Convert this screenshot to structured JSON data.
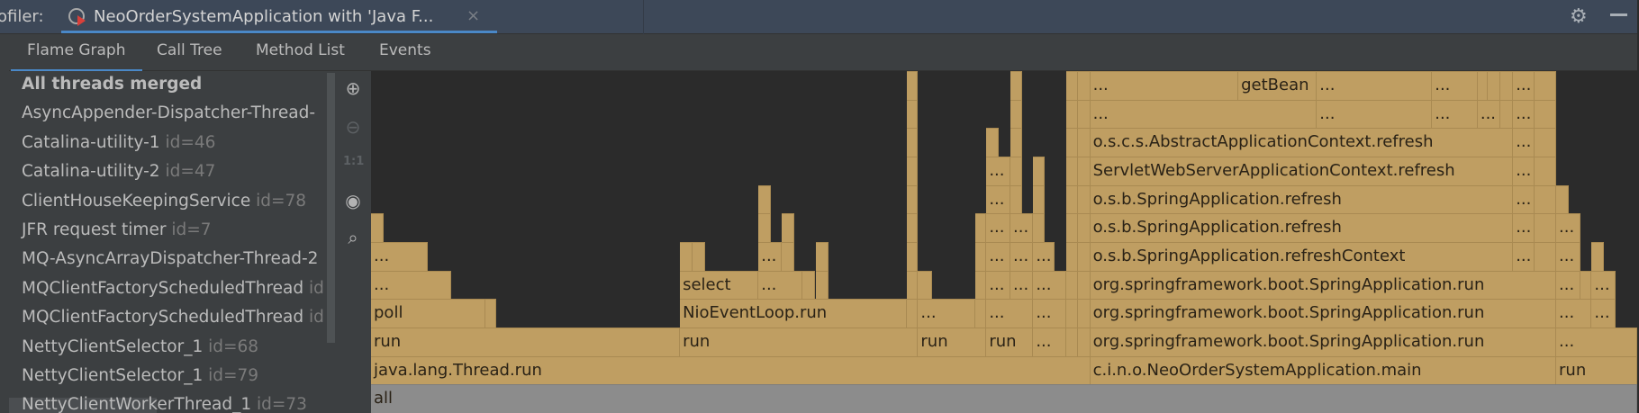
{
  "header": {
    "prefix": "ofiler:",
    "run_tab_title": "NeoOrderSystemApplication with 'Java F...",
    "close_icon": "×",
    "icons": {
      "run": "profiler-run-icon",
      "settings": "gear-icon",
      "minimize": "minimize-icon"
    }
  },
  "tabs": [
    {
      "label": "Flame Graph",
      "active": true
    },
    {
      "label": "Call Tree"
    },
    {
      "label": "Method List"
    },
    {
      "label": "Events"
    }
  ],
  "threads": [
    {
      "name": "All threads merged",
      "id": ""
    },
    {
      "name": "AsyncAppender-Dispatcher-Thread-",
      "id": ""
    },
    {
      "name": "Catalina-utility-1",
      "id": "id=46"
    },
    {
      "name": "Catalina-utility-2",
      "id": "id=47"
    },
    {
      "name": "ClientHouseKeepingService",
      "id": "id=78"
    },
    {
      "name": "JFR request timer",
      "id": "id=7"
    },
    {
      "name": "MQ-AsyncArrayDispatcher-Thread-2",
      "id": ""
    },
    {
      "name": "MQClientFactoryScheduledThread",
      "id": "id"
    },
    {
      "name": "MQClientFactoryScheduledThread",
      "id": "id"
    },
    {
      "name": "NettyClientSelector_1",
      "id": "id=68"
    },
    {
      "name": "NettyClientSelector_1",
      "id": "id=79"
    },
    {
      "name": "NettyClientWorkerThread_1",
      "id": "id=73"
    }
  ],
  "toolbar": [
    {
      "name": "zoom-in-icon",
      "glyph": "⊕"
    },
    {
      "name": "zoom-out-icon",
      "glyph": "⊖"
    },
    {
      "name": "actual-size-icon",
      "glyph": "1:1"
    },
    {
      "name": "eye-icon",
      "glyph": "◉"
    },
    {
      "name": "search-icon",
      "glyph": "⌕"
    }
  ],
  "colors": {
    "frame": "#bf9e62",
    "root": "#8c8c8c",
    "background": "#2b2b2b",
    "accent": "#4a88c7"
  },
  "flame_frames_note_units": "depth, start %, end % of samples, label",
  "frames": [
    [
      0,
      0,
      100,
      "all"
    ],
    [
      1,
      0,
      56.8,
      "java.lang.Thread.run"
    ],
    [
      1,
      56.8,
      93.6,
      "c.i.n.o.NeoOrderSystemApplication.main"
    ],
    [
      1,
      93.6,
      100,
      "run"
    ],
    [
      2,
      0,
      24.4,
      "run"
    ],
    [
      2,
      24.4,
      43.2,
      "run"
    ],
    [
      2,
      43.2,
      48.6,
      "run"
    ],
    [
      2,
      48.6,
      52.3,
      "run"
    ],
    [
      2,
      52.3,
      54.9,
      "..."
    ],
    [
      2,
      56.8,
      93.6,
      "org.springframework.boot.SpringApplication.run"
    ],
    [
      2,
      93.6,
      100,
      "..."
    ],
    [
      3,
      0,
      9.0,
      "poll"
    ],
    [
      3,
      9.0,
      9.9,
      ""
    ],
    [
      3,
      24.4,
      42.3,
      "NioEventLoop.run"
    ],
    [
      3,
      42.3,
      43.2,
      ""
    ],
    [
      3,
      43.2,
      47.7,
      "..."
    ],
    [
      3,
      47.7,
      48.6,
      ""
    ],
    [
      3,
      48.6,
      52.3,
      "..."
    ],
    [
      3,
      52.3,
      54.9,
      "..."
    ],
    [
      3,
      56.8,
      93.6,
      "org.springframework.boot.SpringApplication.run"
    ],
    [
      3,
      93.6,
      96.4,
      "..."
    ],
    [
      3,
      96.4,
      98.3,
      "..."
    ],
    [
      4,
      0,
      6.3,
      "..."
    ],
    [
      4,
      24.4,
      30.6,
      "select"
    ],
    [
      4,
      30.6,
      34.1,
      "..."
    ],
    [
      4,
      34.1,
      35.1,
      ""
    ],
    [
      4,
      35.1,
      36.1,
      ""
    ],
    [
      4,
      42.3,
      43.2,
      ""
    ],
    [
      4,
      43.2,
      44.3,
      ""
    ],
    [
      4,
      47.7,
      48.6,
      ""
    ],
    [
      4,
      48.6,
      50.5,
      "..."
    ],
    [
      4,
      50.5,
      52.3,
      "..."
    ],
    [
      4,
      52.3,
      54.9,
      "..."
    ],
    [
      4,
      56.8,
      93.6,
      "org.springframework.boot.SpringApplication.run"
    ],
    [
      4,
      93.6,
      95.5,
      "..."
    ],
    [
      4,
      95.5,
      96.4,
      ""
    ],
    [
      4,
      96.4,
      98.3,
      "..."
    ],
    [
      5,
      0,
      4.5,
      "..."
    ],
    [
      5,
      24.4,
      25.4,
      ""
    ],
    [
      5,
      25.4,
      26.4,
      ""
    ],
    [
      5,
      30.6,
      32.4,
      "..."
    ],
    [
      5,
      32.4,
      33.4,
      ""
    ],
    [
      5,
      35.1,
      36.1,
      ""
    ],
    [
      5,
      42.3,
      43.2,
      ""
    ],
    [
      5,
      47.7,
      48.6,
      ""
    ],
    [
      5,
      48.6,
      50.5,
      "..."
    ],
    [
      5,
      50.5,
      52.3,
      "..."
    ],
    [
      5,
      52.3,
      54.0,
      "..."
    ],
    [
      5,
      56.8,
      90.2,
      "o.s.b.SpringApplication.refreshContext"
    ],
    [
      5,
      90.2,
      91.9,
      "..."
    ],
    [
      5,
      91.9,
      93.6,
      ""
    ],
    [
      5,
      93.6,
      95.5,
      "..."
    ],
    [
      5,
      96.4,
      97.4,
      ""
    ],
    [
      6,
      0,
      1.0,
      ""
    ],
    [
      6,
      30.6,
      31.6,
      ""
    ],
    [
      6,
      32.4,
      33.4,
      ""
    ],
    [
      6,
      42.3,
      43.2,
      ""
    ],
    [
      6,
      47.7,
      48.6,
      ""
    ],
    [
      6,
      48.6,
      50.5,
      "..."
    ],
    [
      6,
      50.5,
      52.3,
      "..."
    ],
    [
      6,
      52.3,
      53.2,
      ""
    ],
    [
      6,
      56.8,
      90.2,
      "o.s.b.SpringApplication.refresh"
    ],
    [
      6,
      90.2,
      91.9,
      "..."
    ],
    [
      6,
      91.9,
      93.6,
      ""
    ],
    [
      6,
      93.6,
      95.5,
      "..."
    ],
    [
      7,
      30.6,
      31.6,
      ""
    ],
    [
      7,
      42.3,
      43.2,
      ""
    ],
    [
      7,
      48.6,
      50.5,
      "..."
    ],
    [
      7,
      50.5,
      51.4,
      ""
    ],
    [
      7,
      52.3,
      53.2,
      ""
    ],
    [
      7,
      56.8,
      90.2,
      "o.s.b.SpringApplication.refresh"
    ],
    [
      7,
      90.2,
      91.9,
      "..."
    ],
    [
      7,
      91.9,
      93.6,
      ""
    ],
    [
      7,
      93.6,
      94.6,
      ""
    ],
    [
      8,
      42.3,
      43.2,
      ""
    ],
    [
      8,
      48.6,
      50.5,
      "..."
    ],
    [
      8,
      50.5,
      51.4,
      ""
    ],
    [
      8,
      52.3,
      53.2,
      ""
    ],
    [
      8,
      56.8,
      90.2,
      "ServletWebServerApplicationContext.refresh"
    ],
    [
      8,
      90.2,
      91.9,
      "..."
    ],
    [
      8,
      91.9,
      93.6,
      ""
    ],
    [
      9,
      42.3,
      43.2,
      ""
    ],
    [
      9,
      48.6,
      49.6,
      ""
    ],
    [
      9,
      50.5,
      51.4,
      ""
    ],
    [
      9,
      56.8,
      90.2,
      "o.s.c.s.AbstractApplicationContext.refresh"
    ],
    [
      9,
      90.2,
      91.9,
      "..."
    ],
    [
      9,
      91.9,
      93.6,
      ""
    ],
    [
      10,
      42.3,
      43.2,
      ""
    ],
    [
      10,
      50.5,
      51.4,
      ""
    ],
    [
      10,
      56.8,
      74.7,
      "..."
    ],
    [
      10,
      74.7,
      83.8,
      "..."
    ],
    [
      10,
      83.8,
      87.4,
      "..."
    ],
    [
      10,
      87.4,
      89.2,
      "..."
    ],
    [
      10,
      89.2,
      90.2,
      ""
    ],
    [
      10,
      90.2,
      91.9,
      "..."
    ],
    [
      10,
      91.9,
      93.6,
      ""
    ],
    [
      11,
      42.3,
      43.2,
      ""
    ],
    [
      11,
      50.5,
      51.4,
      ""
    ],
    [
      11,
      56.8,
      68.5,
      "..."
    ],
    [
      11,
      68.5,
      74.7,
      "getBean"
    ],
    [
      11,
      74.7,
      83.8,
      "..."
    ],
    [
      11,
      83.8,
      87.4,
      "..."
    ],
    [
      11,
      87.4,
      88.2,
      ""
    ],
    [
      11,
      88.2,
      89.2,
      ""
    ],
    [
      11,
      89.2,
      90.2,
      ""
    ],
    [
      11,
      90.2,
      91.9,
      "..."
    ],
    [
      11,
      91.9,
      93.6,
      ""
    ]
  ]
}
